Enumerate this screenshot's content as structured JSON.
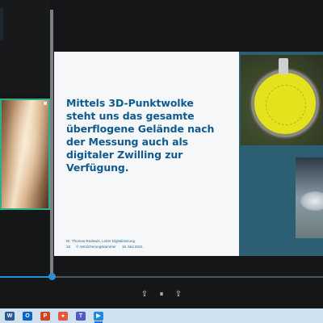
{
  "slide": {
    "title_lines": [
      "Mittels 3D-Punktwolke",
      "steht uns das gesamte",
      "überflogene Gelände nach",
      "der Messung auch als",
      "digitaler Zwilling zur",
      "Verfügung."
    ],
    "footer": {
      "presenter": "Dr. Thomas Redewis, Leiter Digitalisierung",
      "page_number": "18",
      "copyright": "© Versicherungskammer",
      "date": "18. Mai 2021"
    }
  },
  "player": {
    "progress": 0.16,
    "buttons": {
      "previous": "⇪",
      "pause": "⏸",
      "next": "⇪"
    }
  },
  "taskbar": {
    "apps": [
      {
        "name": "word-icon",
        "glyph": "W",
        "color": "#2b579a"
      },
      {
        "name": "outlook-icon",
        "glyph": "O",
        "color": "#0a64c8"
      },
      {
        "name": "powerpoint-icon",
        "glyph": "P",
        "color": "#d04423"
      },
      {
        "name": "browser-icon",
        "glyph": "●",
        "color": "#e8553a"
      },
      {
        "name": "teams-icon",
        "glyph": "T",
        "color": "#5059c9"
      },
      {
        "name": "video-player-icon",
        "glyph": "▶",
        "color": "#1e88e5"
      }
    ]
  },
  "colors": {
    "accent": "#2b8fd6",
    "slide_title": "#0f5b8f",
    "slide_side": "#2c5f74",
    "camera_border": "#2fae8a"
  }
}
